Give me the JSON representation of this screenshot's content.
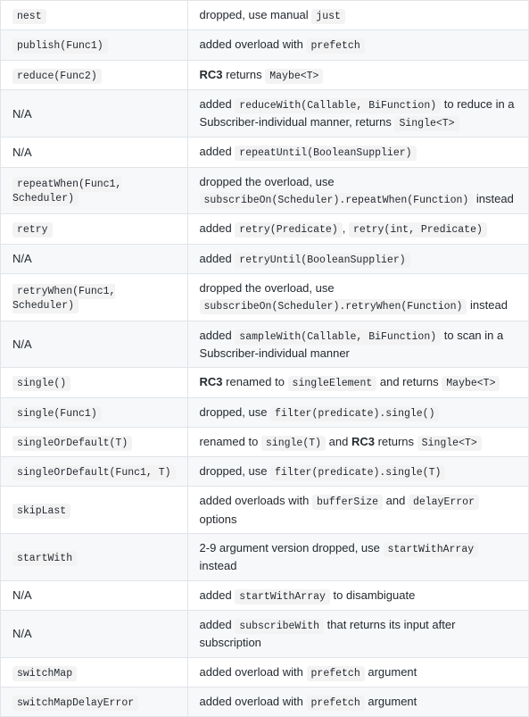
{
  "rows": [
    {
      "leftCode": "nest",
      "right": [
        {
          "t": "text",
          "v": "dropped, use manual "
        },
        {
          "t": "code",
          "v": "just"
        }
      ]
    },
    {
      "leftCode": "publish(Func1)",
      "shade": true,
      "right": [
        {
          "t": "text",
          "v": "added overload with "
        },
        {
          "t": "code",
          "v": "prefetch"
        }
      ]
    },
    {
      "leftCode": "reduce(Func2)",
      "right": [
        {
          "t": "bold",
          "v": "RC3"
        },
        {
          "t": "text",
          "v": " returns "
        },
        {
          "t": "code",
          "v": "Maybe<T>"
        }
      ]
    },
    {
      "leftText": "N/A",
      "shade": true,
      "right": [
        {
          "t": "text",
          "v": "added "
        },
        {
          "t": "code",
          "v": "reduceWith(Callable, BiFunction)"
        },
        {
          "t": "text",
          "v": " to reduce in a Subscriber-individual manner, returns "
        },
        {
          "t": "code",
          "v": "Single<T>"
        }
      ]
    },
    {
      "leftText": "N/A",
      "right": [
        {
          "t": "text",
          "v": "added "
        },
        {
          "t": "code",
          "v": "repeatUntil(BooleanSupplier)"
        }
      ]
    },
    {
      "leftCode": "repeatWhen(Func1, Scheduler)",
      "shade": true,
      "leftWrap": true,
      "right": [
        {
          "t": "text",
          "v": "dropped the overload, use "
        },
        {
          "t": "code",
          "v": "subscribeOn(Scheduler).repeatWhen(Function)"
        },
        {
          "t": "text",
          "v": " instead"
        }
      ]
    },
    {
      "leftCode": "retry",
      "right": [
        {
          "t": "text",
          "v": "added "
        },
        {
          "t": "code",
          "v": "retry(Predicate)"
        },
        {
          "t": "text",
          "v": ", "
        },
        {
          "t": "code",
          "v": "retry(int, Predicate)"
        }
      ]
    },
    {
      "leftText": "N/A",
      "shade": true,
      "right": [
        {
          "t": "text",
          "v": "added "
        },
        {
          "t": "code",
          "v": "retryUntil(BooleanSupplier)"
        }
      ]
    },
    {
      "leftCode": "retryWhen(Func1, Scheduler)",
      "leftWrap": true,
      "right": [
        {
          "t": "text",
          "v": "dropped the overload, use "
        },
        {
          "t": "code",
          "v": "subscribeOn(Scheduler).retryWhen(Function)"
        },
        {
          "t": "text",
          "v": " instead"
        }
      ]
    },
    {
      "leftText": "N/A",
      "shade": true,
      "right": [
        {
          "t": "text",
          "v": "added "
        },
        {
          "t": "code",
          "v": "sampleWith(Callable, BiFunction)"
        },
        {
          "t": "text",
          "v": " to scan in a Subscriber-individual manner"
        }
      ]
    },
    {
      "leftCode": "single()",
      "right": [
        {
          "t": "bold",
          "v": "RC3"
        },
        {
          "t": "text",
          "v": " renamed to "
        },
        {
          "t": "code",
          "v": "singleElement"
        },
        {
          "t": "text",
          "v": " and returns "
        },
        {
          "t": "code",
          "v": "Maybe<T>"
        }
      ]
    },
    {
      "leftCode": "single(Func1)",
      "shade": true,
      "right": [
        {
          "t": "text",
          "v": "dropped, use "
        },
        {
          "t": "code",
          "v": "filter(predicate).single()"
        }
      ]
    },
    {
      "leftCode": "singleOrDefault(T)",
      "right": [
        {
          "t": "text",
          "v": "renamed to "
        },
        {
          "t": "code",
          "v": "single(T)"
        },
        {
          "t": "text",
          "v": " and "
        },
        {
          "t": "bold",
          "v": "RC3"
        },
        {
          "t": "text",
          "v": " returns "
        },
        {
          "t": "code",
          "v": "Single<T>"
        }
      ]
    },
    {
      "leftCode": "singleOrDefault(Func1, T)",
      "shade": true,
      "right": [
        {
          "t": "text",
          "v": "dropped, use "
        },
        {
          "t": "code",
          "v": "filter(predicate).single(T)"
        }
      ]
    },
    {
      "leftCode": "skipLast",
      "right": [
        {
          "t": "text",
          "v": "added overloads with "
        },
        {
          "t": "code",
          "v": "bufferSize"
        },
        {
          "t": "text",
          "v": " and "
        },
        {
          "t": "code",
          "v": "delayError"
        },
        {
          "t": "text",
          "v": " options"
        }
      ]
    },
    {
      "leftCode": "startWith",
      "shade": true,
      "right": [
        {
          "t": "text",
          "v": "2-9 argument version dropped, use "
        },
        {
          "t": "code",
          "v": "startWithArray"
        },
        {
          "t": "text",
          "v": " instead"
        }
      ]
    },
    {
      "leftText": "N/A",
      "right": [
        {
          "t": "text",
          "v": "added "
        },
        {
          "t": "code",
          "v": "startWithArray"
        },
        {
          "t": "text",
          "v": " to disambiguate"
        }
      ]
    },
    {
      "leftText": "N/A",
      "shade": true,
      "right": [
        {
          "t": "text",
          "v": "added "
        },
        {
          "t": "code",
          "v": "subscribeWith"
        },
        {
          "t": "text",
          "v": " that returns its input after subscription"
        }
      ]
    },
    {
      "leftCode": "switchMap",
      "right": [
        {
          "t": "text",
          "v": "added overload with "
        },
        {
          "t": "code",
          "v": "prefetch"
        },
        {
          "t": "text",
          "v": " argument"
        }
      ]
    },
    {
      "leftCode": "switchMapDelayError",
      "shade": true,
      "right": [
        {
          "t": "text",
          "v": "added overload with "
        },
        {
          "t": "code",
          "v": "prefetch"
        },
        {
          "t": "text",
          "v": " argument"
        }
      ]
    }
  ]
}
